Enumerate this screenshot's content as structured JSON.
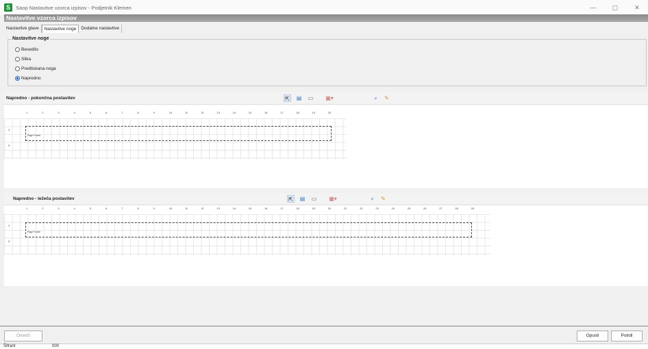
{
  "window": {
    "title": "Saop Nastavitve vzorca izpisov - Podjetnik Klemen",
    "app_icon_letter": "S",
    "minimize": "—",
    "maximize": "▢",
    "close": "✕"
  },
  "header": {
    "title": "Nastavitve vzorca izpisov"
  },
  "tabs": [
    {
      "label": "Nastavitve glave"
    },
    {
      "label": "Nastavitve noge"
    },
    {
      "label": "Dodatne nastavitve"
    }
  ],
  "footer_settings": {
    "title": "Nastavitve noge",
    "options": [
      {
        "label": "Besedilo",
        "selected": false
      },
      {
        "label": "Slika",
        "selected": false
      },
      {
        "label": "Predtiskana noga",
        "selected": false
      },
      {
        "label": "Napredno",
        "selected": true
      }
    ]
  },
  "portrait": {
    "title": "Napredno - pokončna postavitev",
    "ruler": [
      "1",
      "2",
      "3",
      "4",
      "5",
      "6",
      "7",
      "8",
      "9",
      "10",
      "11",
      "12",
      "13",
      "14",
      "15",
      "16",
      "17",
      "18",
      "19",
      "20"
    ],
    "rows": [
      "1",
      "2"
    ],
    "band_label": "Page Footer"
  },
  "landscape": {
    "title": "Napredno - ležeča postavitev",
    "ruler": [
      "1",
      "2",
      "3",
      "4",
      "5",
      "6",
      "7",
      "8",
      "9",
      "10",
      "11",
      "12",
      "13",
      "14",
      "15",
      "16",
      "17",
      "18",
      "19",
      "20",
      "21",
      "22",
      "23",
      "24",
      "25",
      "26",
      "27",
      "28",
      "29"
    ],
    "rows": [
      "1",
      "2"
    ],
    "band_label": "Page Footer"
  },
  "buttons": {
    "refresh": "Osveži",
    "cancel": "Opusti",
    "confirm": "Potrdi"
  },
  "statusbar": {
    "left": "Šifrant",
    "code": "000"
  },
  "colors": {
    "accent": "#1a5fb4",
    "app_icon": "#1f8f3a",
    "header_band": "#9a9a9a"
  }
}
